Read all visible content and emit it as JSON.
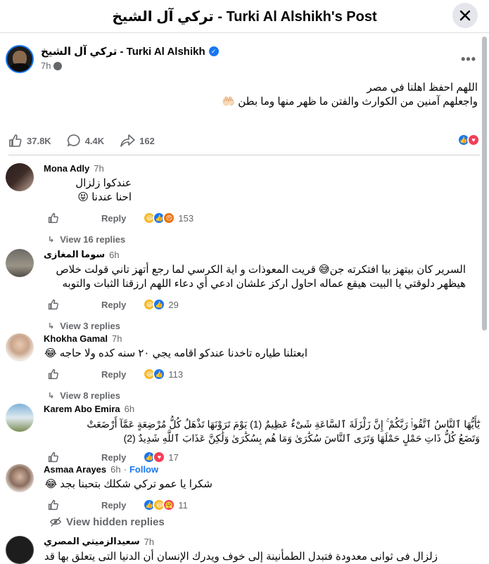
{
  "header": {
    "title": "تركي آل الشيخ - Turki Al Alshikh's Post"
  },
  "post": {
    "author": "تركي آل الشيخ - Turki Al Alshikh",
    "time": "7h",
    "text_line1": "اللهم احفظ اهلنا في مصر",
    "text_line2": "واجعلهم آمنين من الكوارث والفتن ما ظهر منها وما بطن 🤲🏻",
    "likes": "37.8K",
    "comments": "4.4K",
    "shares": "162"
  },
  "comments": [
    {
      "name": "Mona Adly",
      "time": "7h",
      "text_lines": [
        "عندكوا زلزال",
        "احنا عندنا 😝"
      ],
      "reply_label": "Reply",
      "react_count": "153",
      "view_replies": "View 16 replies"
    },
    {
      "name": "سوما المغازى",
      "time": "6h",
      "text_lines": [
        "السرير كان بيتهز بيا افتكرته جن😅 قريت المعوذات و اية الكرسي لما رجع أتهز تاني قولت خلاص",
        "هيظهر دلوقتي يا البيت هيقع عماله احاول اركز علشان ادعي أي دعاء اللهم ارزقنا الثبات والتوبه"
      ],
      "reply_label": "Reply",
      "react_count": "29",
      "view_replies": "View 3 replies"
    },
    {
      "name": "Khokha Gamal",
      "time": "7h",
      "text_lines": [
        "ابعتلنا طياره تاخدنا عندكو اقامه يجي ٢٠ سنه كده ولا حاجه 😂"
      ],
      "reply_label": "Reply",
      "react_count": "113",
      "view_replies": "View 8 replies"
    },
    {
      "name": "Karem Abo Emira",
      "time": "6h",
      "text_lines": [
        "يَٰٓأَيُّهَا ٱلنَّاسُ ٱتَّقُوا۟ رَبَّكُمْ ۚ إِنَّ زَلْزَلَةَ ٱلسَّاعَةِ شَىْءٌ عَظِيمٌ (1) يَوْمَ تَرَوْنَهَا تَذْهَلُ كُلُّ مُرْضِعَةٍ عَمَّآ أَرْضَعَتْ",
        "وَتَضَعُ كُلُّ ذَاتِ حَمْلٍ حَمْلَهَا وَتَرَى ٱلنَّاسَ سُكَٰرَىٰ وَمَا هُم بِسُكَٰرَىٰ وَلَٰكِنَّ عَذَابَ ٱللَّهِ شَدِيدٌ (2)"
      ],
      "reply_label": "Reply",
      "react_count": "17"
    },
    {
      "name": "Asmaa Arayes",
      "time": "6h",
      "follow": "Follow",
      "text_lines": [
        "شكرا يا عمو تركي شكلك بتحبنا بجد 😂"
      ],
      "reply_label": "Reply",
      "react_count": "11"
    },
    {
      "name": "سعيدالزميتي المصري",
      "time": "7h",
      "text_lines": [
        "زلزال فى ثوانى معدودة فتبدل الطمأنينة إلى خوف ويدرك الإنسان أن الدنيا التى يتعلق بها قد"
      ]
    }
  ],
  "view_hidden_replies": "View hidden replies",
  "colors": {
    "accent": "#1877f2",
    "muted": "#65676b"
  }
}
